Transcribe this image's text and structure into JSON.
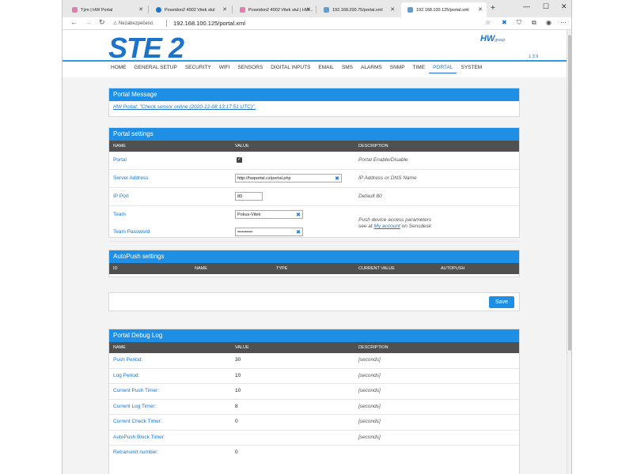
{
  "browser": {
    "tabs": [
      {
        "label": "Tým | HW Portal",
        "fav_color": "#e57bb0"
      },
      {
        "label": "Poseidon2 4002 Vitek stul",
        "fav_color": "#1b74c9"
      },
      {
        "label": "Poseidon2 4002 Vitek stul | HW...",
        "fav_color": "#e57bb0"
      },
      {
        "label": "192.168.200.75/portal.xml",
        "fav_color": "#5aa0d8"
      },
      {
        "label": "192.168.100.125/portal.xml",
        "fav_color": "#5aa0d8"
      }
    ],
    "security_label": "Nezabezpečeno",
    "url": "192.168.100.125/portal.xml"
  },
  "header": {
    "logo": "STE 2",
    "brand": "HW",
    "brand_sub": "group",
    "version": "1.3.9"
  },
  "menu": [
    "HOME",
    "GENERAL SETUP",
    "SECURITY",
    "WIFI",
    "SENSORS",
    "DIGITAL INPUTS",
    "EMAIL",
    "SMS",
    "ALARMS",
    "SNMP",
    "TIME",
    "PORTAL",
    "SYSTEM"
  ],
  "portal_message": {
    "title": "Portal Message",
    "text": "HW Portal: \"Check sensor online (2020-12-08 13:17:51 UTC)\"."
  },
  "portal_settings": {
    "title": "Portal settings",
    "columns": [
      "NAME",
      "VALUE",
      "DESCRIPTION"
    ],
    "portal_label": "Portal",
    "portal_desc": "Portal Enable/Disable",
    "server_label": "Server Address",
    "server_value": "http://hwportal.cz/portal.php",
    "server_desc": "IP Address or DNS Name",
    "port_label": "IP Port",
    "port_value": "80",
    "port_desc": "Default 80",
    "team_label": "Team",
    "team_value": "Pokus-Vitek",
    "team_desc": "Push device access parameters",
    "team_desc2_pre": "see at",
    "team_desc2_link": "My account",
    "team_desc2_post": "on Sensdesk",
    "password_label": "Team Password",
    "password_value": "••••••••••"
  },
  "autopush": {
    "title": "AutoPush settings",
    "columns": [
      "ID",
      "NAME",
      "TYPE",
      "CURRENT VALUE",
      "AUTOPUSH"
    ]
  },
  "save_label": "Save",
  "debug": {
    "title": "Portal Debug Log",
    "columns": [
      "NAME",
      "VALUE",
      "DESCRIPTION"
    ],
    "rows": [
      {
        "name": "Push Period:",
        "value": "30",
        "desc": "[seconds]"
      },
      {
        "name": "Log Period:",
        "value": "10",
        "desc": "[seconds]"
      },
      {
        "name": "Current Push Timer:",
        "value": "10",
        "desc": "[seconds]"
      },
      {
        "name": "Current Log Timer:",
        "value": "8",
        "desc": "[seconds]"
      },
      {
        "name": "Current Check Timer:",
        "value": "0",
        "desc": "[seconds]"
      },
      {
        "name": "AutoPush Block Timer:",
        "value": "",
        "desc": "[seconds]"
      },
      {
        "name": "Retransmit number:",
        "value": "0",
        "desc": ""
      }
    ]
  }
}
